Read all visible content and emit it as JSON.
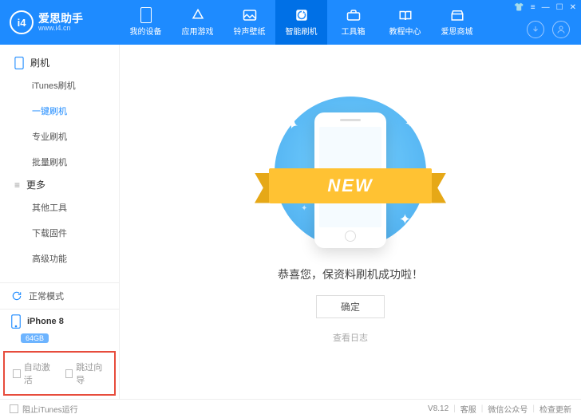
{
  "app": {
    "name": "爱思助手",
    "url": "www.i4.cn",
    "logo_text": "i4",
    "version": "V8.12"
  },
  "nav": {
    "items": [
      {
        "label": "我的设备"
      },
      {
        "label": "应用游戏"
      },
      {
        "label": "铃声壁纸"
      },
      {
        "label": "智能刷机"
      },
      {
        "label": "工具箱"
      },
      {
        "label": "教程中心"
      },
      {
        "label": "爱思商城"
      }
    ]
  },
  "sidebar": {
    "group1": "刷机",
    "items1": [
      "iTunes刷机",
      "一键刷机",
      "专业刷机",
      "批量刷机"
    ],
    "group2": "更多",
    "items2": [
      "其他工具",
      "下载固件",
      "高级功能"
    ],
    "mode": "正常模式",
    "device": "iPhone 8",
    "storage": "64GB",
    "chk_auto": "自动激活",
    "chk_skip": "跳过向导"
  },
  "main": {
    "ribbon": "NEW",
    "success": "恭喜您，保资料刷机成功啦！",
    "confirm": "确定",
    "log": "查看日志"
  },
  "footer": {
    "block_itunes": "阻止iTunes运行",
    "support": "客服",
    "wechat": "微信公众号",
    "update": "检查更新"
  }
}
